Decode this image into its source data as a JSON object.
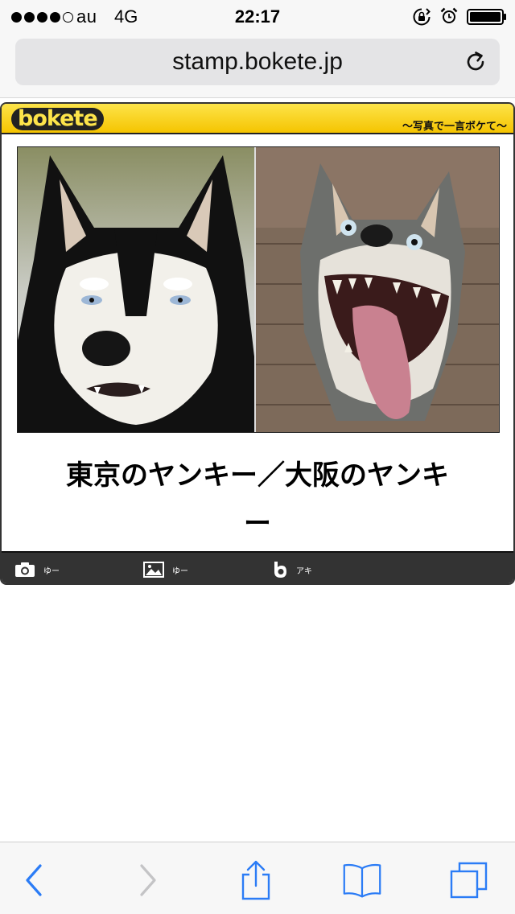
{
  "status_bar": {
    "carrier": "au",
    "network": "4G",
    "time": "22:17",
    "signal_bars_filled": 4,
    "signal_bars_total": 5,
    "icons": [
      "rotation-lock-icon",
      "alarm-icon",
      "battery-icon"
    ]
  },
  "browser": {
    "url": "stamp.bokete.jp",
    "reload_icon": "reload-icon",
    "accent_color": "#2b7cf6"
  },
  "card": {
    "logo": "bokete",
    "tagline": "〜写真で一言ボケて〜",
    "caption_line1": "東京のヤンキー／大阪のヤンキ",
    "caption_line2": "ー",
    "header_color": "#f5c400",
    "footer_credits": [
      {
        "icon": "camera-icon",
        "name": "ゆー"
      },
      {
        "icon": "image-icon",
        "name": "ゆー"
      },
      {
        "icon": "bokete-b-icon",
        "name": "アキ"
      }
    ]
  },
  "toolbar": {
    "buttons": [
      "back-icon",
      "forward-icon",
      "share-icon",
      "bookmarks-icon",
      "tabs-icon"
    ]
  }
}
